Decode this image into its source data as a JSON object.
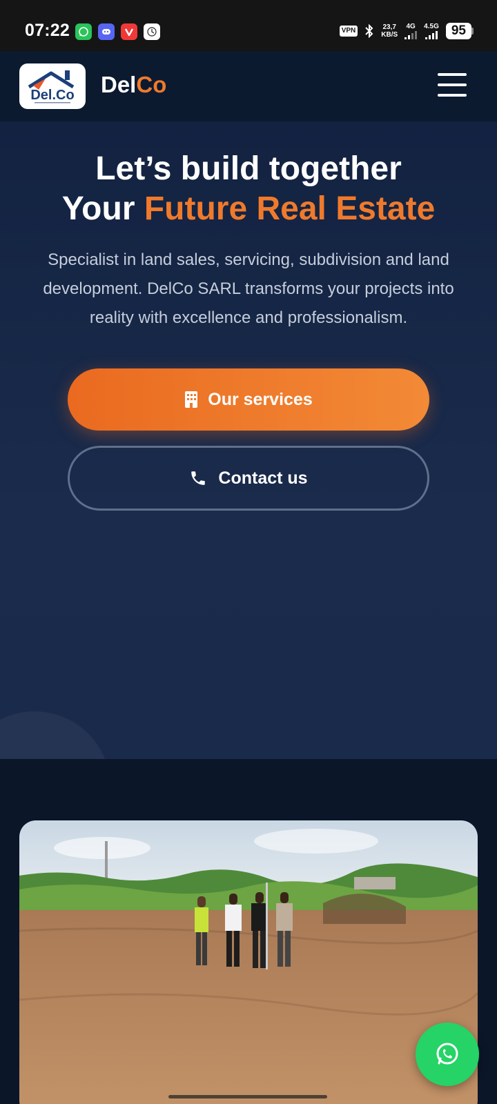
{
  "status_bar": {
    "time": "07:22",
    "apps": [
      "whatsapp-icon",
      "discord-icon",
      "vivaldi-icon",
      "clock-icon"
    ],
    "vpn": "VPN",
    "speed_value": "23,7",
    "speed_unit": "KB/S",
    "net1": "4G",
    "net2": "4.5G",
    "battery": "95"
  },
  "header": {
    "logo_text": "Del.Co",
    "brand_part1": "Del",
    "brand_part2": "Co"
  },
  "hero": {
    "title_line1": "Let’s build together",
    "title_line2_prefix": "Your ",
    "title_line2_accent": "Future Real Estate",
    "subtitle": "Specialist in land sales, servicing, subdivision and land development. DelCo SARL transforms your projects into reality with excellence and professionalism.",
    "primary_button": "Our services",
    "secondary_button": "Contact us"
  },
  "colors": {
    "accent": "#ef7a2c",
    "header_bg": "#0c1a30",
    "hero_bg": "#1a2b4b",
    "whatsapp": "#25d366"
  }
}
